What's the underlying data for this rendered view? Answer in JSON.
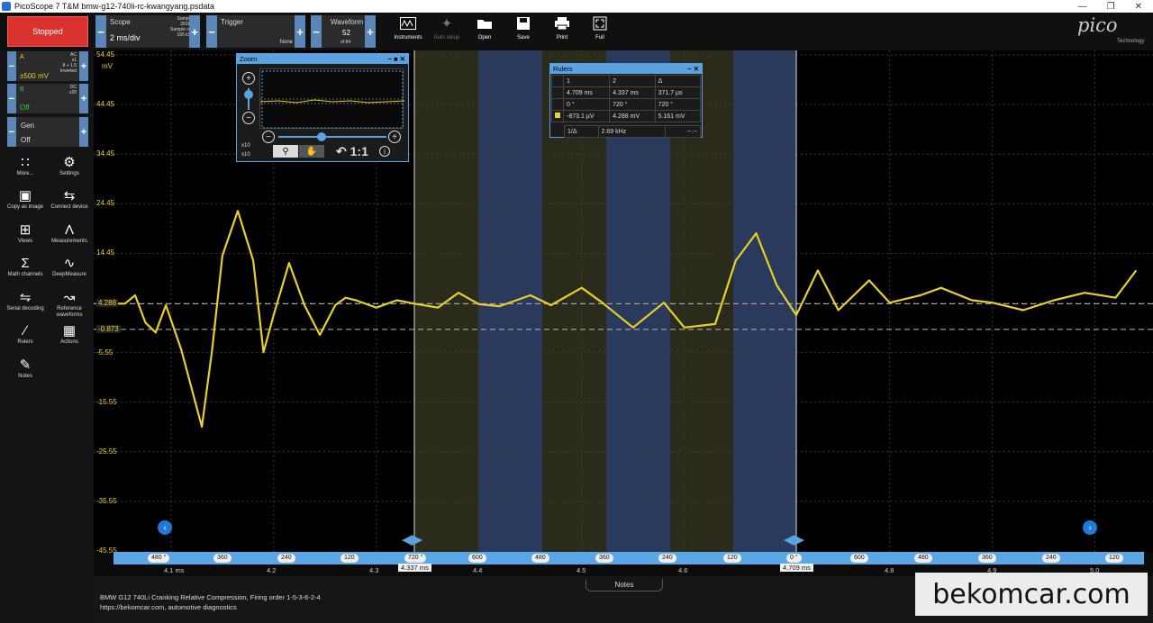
{
  "window": {
    "title": "PicoScope 7 T&M bmw-g12-740li-rc-kwangyang.psdata"
  },
  "toolbar": {
    "status": "Stopped",
    "scope": {
      "label": "Scope",
      "value": "2 ms/div",
      "samples_label": "Samples",
      "samples": "3918 S",
      "rate_label": "Sample rate",
      "rate": "195 kS/s"
    },
    "trigger": {
      "label": "Trigger",
      "mode": "None"
    },
    "waveform": {
      "label": "Waveform",
      "index": "52",
      "of": "of 84"
    },
    "buttons": [
      {
        "label": "Instruments",
        "icon": "instruments-icon"
      },
      {
        "label": "Auto setup",
        "icon": "wand-icon"
      },
      {
        "label": "Open",
        "icon": "folder-icon"
      },
      {
        "label": "Save",
        "icon": "save-icon"
      },
      {
        "label": "Print",
        "icon": "printer-icon"
      },
      {
        "label": "Full",
        "icon": "fullscreen-icon"
      }
    ],
    "logo": "pico",
    "logo_sub": "Technology"
  },
  "channels": {
    "a": {
      "name": "A",
      "range": "±500 mV",
      "coupling": "AC",
      "probe": "x1",
      "math": "8 + 1.5",
      "inverted": "Inverted"
    },
    "b": {
      "name": "B",
      "state": "Off",
      "coupling": "DC",
      "probe": "x20"
    },
    "gen": {
      "name": "Gen",
      "state": "Off"
    }
  },
  "sidebar": [
    {
      "label": "More...",
      "icon": "grid-icon"
    },
    {
      "label": "Settings",
      "icon": "gear-icon"
    },
    {
      "label": "Copy as image",
      "icon": "image-icon"
    },
    {
      "label": "Connect device",
      "icon": "usb-icon"
    },
    {
      "label": "Views",
      "icon": "views-icon"
    },
    {
      "label": "Measurements",
      "icon": "measure-icon"
    },
    {
      "label": "Math channels",
      "icon": "sigma-icon"
    },
    {
      "label": "DeepMeasure",
      "icon": "wave-icon"
    },
    {
      "label": "Serial decoding",
      "icon": "serial-icon"
    },
    {
      "label": "Reference waveforms",
      "icon": "reference-icon"
    },
    {
      "label": "Rulers",
      "icon": "ruler-icon"
    },
    {
      "label": "Actions",
      "icon": "clapper-icon"
    },
    {
      "label": "Notes",
      "icon": "notes-icon"
    }
  ],
  "plot": {
    "unit": "mV",
    "y_ticks": [
      "54.45",
      "44.45",
      "34.45",
      "24.45",
      "14.45",
      "4.288",
      "-0.873",
      "-5.55",
      "-15.55",
      "-25.55",
      "-35.55",
      "-45.55"
    ],
    "x_ticks": [
      "480 °",
      "360",
      "240",
      "120",
      "720 °",
      "600",
      "480",
      "360",
      "240",
      "120",
      "0 °",
      "600",
      "480",
      "360",
      "240",
      "120",
      "720 °",
      "600",
      "480",
      "360",
      "240",
      "120"
    ],
    "time_labels": [
      "4.1 ms",
      "4.2",
      "4.3",
      "4.337 ms",
      "4.4",
      "4.5",
      "4.6",
      "4.709 ms",
      "4.8",
      "4.9",
      "5.0"
    ],
    "colors": {
      "trace": "#e8d028",
      "band_olive": "#2b2b1c",
      "band_blue": "#2a3a5c",
      "axis": "#5ba7e6"
    }
  },
  "zoom": {
    "title": "Zoom",
    "zoom_x": "x10",
    "zoom_y": "x10",
    "reset": "1:1"
  },
  "rulers": {
    "title": "Rulers",
    "header": [
      "",
      "1",
      "2",
      "Δ"
    ],
    "rows": [
      [
        "",
        "4.709 ms",
        "4.337 ms",
        "371.7 µs"
      ],
      [
        "",
        "0 °",
        "720 °",
        "720 °"
      ],
      [
        "",
        "-873.1 µV",
        "4.288 mV",
        "5.161 mV"
      ]
    ],
    "freq_label": "1/Δ",
    "freq_value": "2.69 kHz",
    "freq_extra": "--.--"
  },
  "notes": {
    "tab": "Notes",
    "line1": "BMW G12 740Li Cranking Relative Compression, Firing order 1-5-3-6-2-4",
    "line2": "https://bekomcar.com, automotive diagnostics"
  },
  "watermark": "bekomcar.com",
  "chart_data": {
    "type": "line",
    "x_unit": "ms",
    "y_unit": "mV",
    "ylim": [
      -45.55,
      54.45
    ],
    "xlim": [
      4.03,
      5.04
    ],
    "series": [
      {
        "x": [
          4.03,
          4.055,
          4.065,
          4.075,
          4.085,
          4.095,
          4.11,
          4.13,
          4.14,
          4.15,
          4.165,
          4.18,
          4.19,
          4.2,
          4.215,
          4.23,
          4.245,
          4.26,
          4.27,
          4.28,
          4.3,
          4.32,
          4.337,
          4.36,
          4.38,
          4.4,
          4.42,
          4.45,
          4.47,
          4.5,
          4.52,
          4.55,
          4.58,
          4.6,
          4.63,
          4.65,
          4.67,
          4.69,
          4.709,
          4.73,
          4.75,
          4.78,
          4.8,
          4.83,
          4.85,
          4.88,
          4.9,
          4.93,
          4.96,
          4.99,
          5.02,
          5.04
        ],
        "y": [
          4.3,
          4.3,
          6.0,
          0.5,
          -1.5,
          4.0,
          -5.0,
          -20.5,
          -5.0,
          14.0,
          23.0,
          13.0,
          -5.5,
          2.0,
          12.5,
          4.0,
          -2.0,
          4.0,
          5.5,
          5.0,
          3.5,
          5.0,
          4.3,
          3.5,
          6.5,
          4.2,
          3.8,
          6.0,
          4.0,
          7.5,
          4.5,
          -0.5,
          4.5,
          -0.5,
          0.2,
          13.0,
          18.5,
          8.0,
          2.0,
          11.0,
          3.0,
          9.0,
          4.5,
          6.0,
          7.5,
          5.0,
          4.5,
          3.0,
          5.0,
          6.5,
          5.5,
          11.0
        ]
      }
    ],
    "reference_lines": [
      4.288,
      -0.873
    ],
    "rulers_ms": [
      4.337,
      4.709
    ]
  }
}
